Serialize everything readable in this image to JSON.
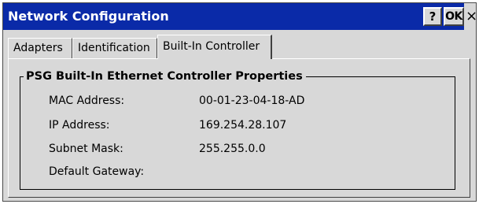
{
  "window": {
    "title": "Network Configuration",
    "help_label": "?",
    "ok_label": "OK",
    "close_label": "×"
  },
  "tabs": [
    {
      "label": "Adapters",
      "selected": false
    },
    {
      "label": "Identification",
      "selected": false
    },
    {
      "label": "Built-In Controller",
      "selected": true
    }
  ],
  "group": {
    "title": "PSG Built-In Ethernet Controller Properties",
    "properties": [
      {
        "label": "MAC Address:",
        "value": "00-01-23-04-18-AD"
      },
      {
        "label": "IP Address:",
        "value": "169.254.28.107"
      },
      {
        "label": "Subnet Mask:",
        "value": "255.255.0.0"
      },
      {
        "label": "Default Gateway:",
        "value": ""
      }
    ]
  },
  "colors": {
    "titlebar": "#0a2aa8",
    "face": "#d8d8d8",
    "title_text": "#ffffff"
  },
  "icons": {
    "help": "question-mark-icon",
    "close": "close-icon"
  }
}
